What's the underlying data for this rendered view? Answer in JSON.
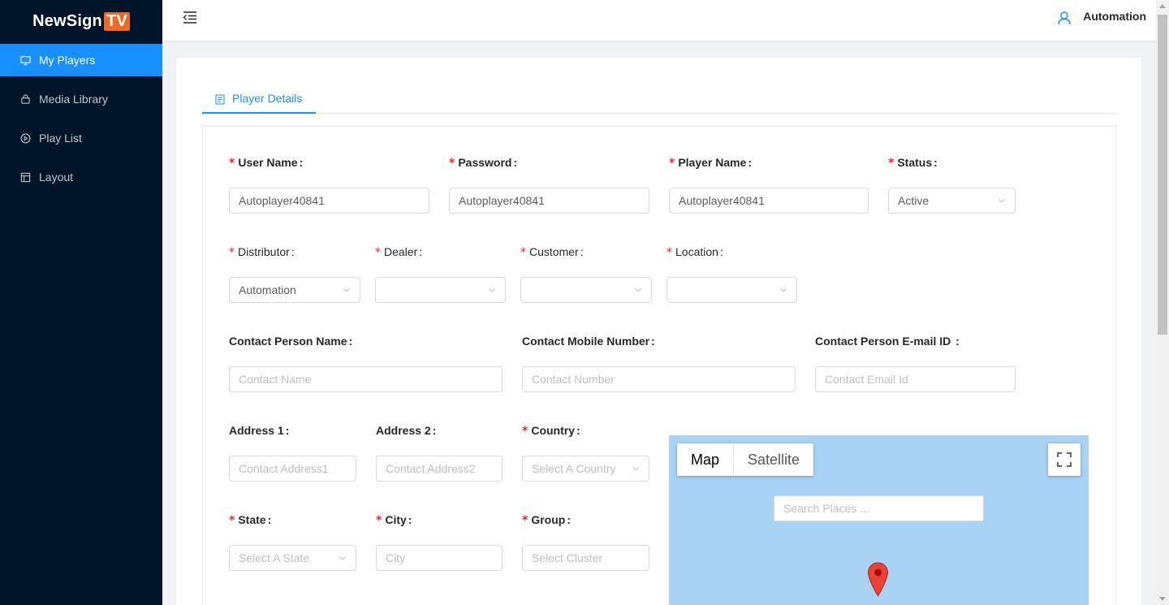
{
  "app": {
    "logo_main": "NewSign",
    "logo_accent": "TV"
  },
  "sidebar": {
    "items": [
      {
        "label": "My Players",
        "icon": "monitor-icon",
        "active": true
      },
      {
        "label": "Media Library",
        "icon": "media-library-icon",
        "active": false
      },
      {
        "label": "Play List",
        "icon": "play-circle-icon",
        "active": false
      },
      {
        "label": "Layout",
        "icon": "layout-icon",
        "active": false
      }
    ]
  },
  "header": {
    "menu_toggle_icon": "menu-fold-icon",
    "user_icon": "user-icon",
    "user_name": "Automation"
  },
  "tabs": {
    "active": {
      "label": "Player Details",
      "icon": "file-text-icon"
    }
  },
  "form": {
    "required_mark": "*",
    "user_name": {
      "label": "User Name",
      "value": "Autoplayer40841"
    },
    "password": {
      "label": "Password",
      "value": "Autoplayer40841"
    },
    "player_name": {
      "label": "Player Name",
      "value": "Autoplayer40841"
    },
    "status": {
      "label": "Status",
      "value": "Active"
    },
    "distributor": {
      "label": "Distributor",
      "value": "Automation"
    },
    "dealer": {
      "label": "Dealer",
      "value": ""
    },
    "customer": {
      "label": "Customer",
      "value": ""
    },
    "location": {
      "label": "Location",
      "value": ""
    },
    "contact_name": {
      "label": "Contact Person Name",
      "placeholder": "Contact Name"
    },
    "contact_mobile": {
      "label": "Contact Mobile Number",
      "placeholder": "Contact Number"
    },
    "contact_email": {
      "label": "Contact Person E-mail ID",
      "placeholder": "Contact Email Id"
    },
    "address1": {
      "label": "Address 1",
      "placeholder": "Contact Address1"
    },
    "address2": {
      "label": "Address 2",
      "placeholder": "Contact Address2"
    },
    "country": {
      "label": "Country",
      "placeholder": "Select A Country"
    },
    "state": {
      "label": "State",
      "placeholder": "Select A State"
    },
    "city": {
      "label": "City",
      "placeholder": "City"
    },
    "group": {
      "label": "Group",
      "placeholder": "Select Cluster"
    }
  },
  "map": {
    "type_map": "Map",
    "type_satellite": "Satellite",
    "search_placeholder": "Search Places ...",
    "fullscreen_icon": "fullscreen-icon",
    "marker_icon": "map-pin-icon",
    "water_color": "#a9d3f5"
  },
  "colors": {
    "primary": "#1890ff",
    "sidebar_bg": "#001529",
    "required": "#f5222d",
    "logo_accent": "#f26a21"
  }
}
